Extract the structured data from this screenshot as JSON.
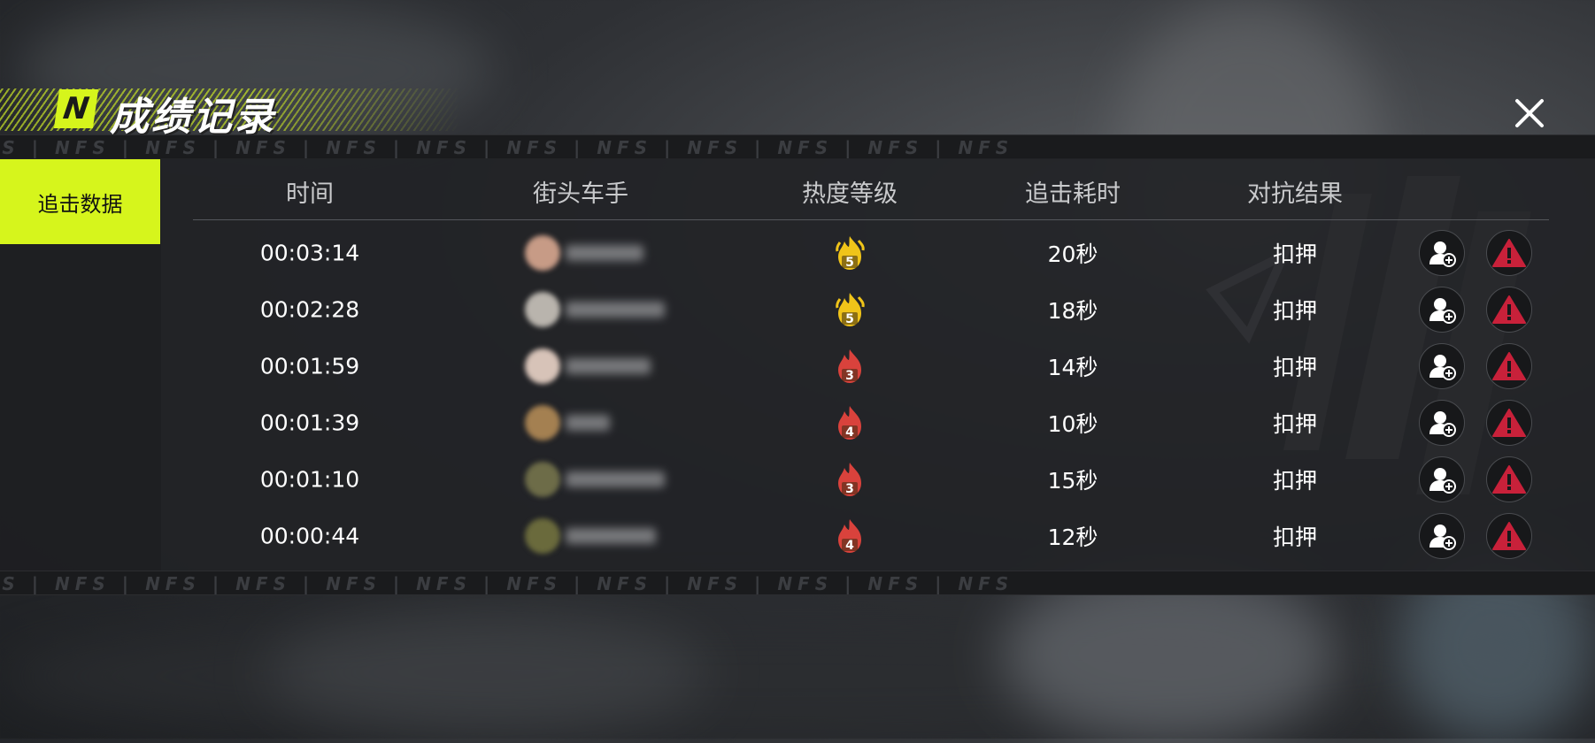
{
  "header": {
    "logo_letter": "N",
    "title": "成绩记录",
    "close_icon": "close-icon"
  },
  "strip": {
    "text": "NFS | NFS | NFS | NFS | NFS | NFS | NFS | NFS | NFS | NFS | NFS | NFS"
  },
  "sidebar": {
    "tabs": [
      {
        "label": "追击数据",
        "active": true
      }
    ]
  },
  "table": {
    "columns": [
      "时间",
      "街头车手",
      "热度等级",
      "追击耗时",
      "对抗结果"
    ],
    "rows": [
      {
        "time": "00:03:14",
        "heat": "5",
        "heat_color": "#f0c419",
        "duration": "20秒",
        "result": "扣押"
      },
      {
        "time": "00:02:28",
        "heat": "5",
        "heat_color": "#f0c419",
        "duration": "18秒",
        "result": "扣押"
      },
      {
        "time": "00:01:59",
        "heat": "3",
        "heat_color": "#d9423c",
        "duration": "14秒",
        "result": "扣押"
      },
      {
        "time": "00:01:39",
        "heat": "4",
        "heat_color": "#d9423c",
        "duration": "10秒",
        "result": "扣押"
      },
      {
        "time": "00:01:10",
        "heat": "3",
        "heat_color": "#d9423c",
        "duration": "15秒",
        "result": "扣押"
      },
      {
        "time": "00:00:44",
        "heat": "4",
        "heat_color": "#d9423c",
        "duration": "12秒",
        "result": "扣押"
      }
    ]
  },
  "colors": {
    "accent": "#d6f51c",
    "report": "#c8213a",
    "panel": "#222326"
  }
}
